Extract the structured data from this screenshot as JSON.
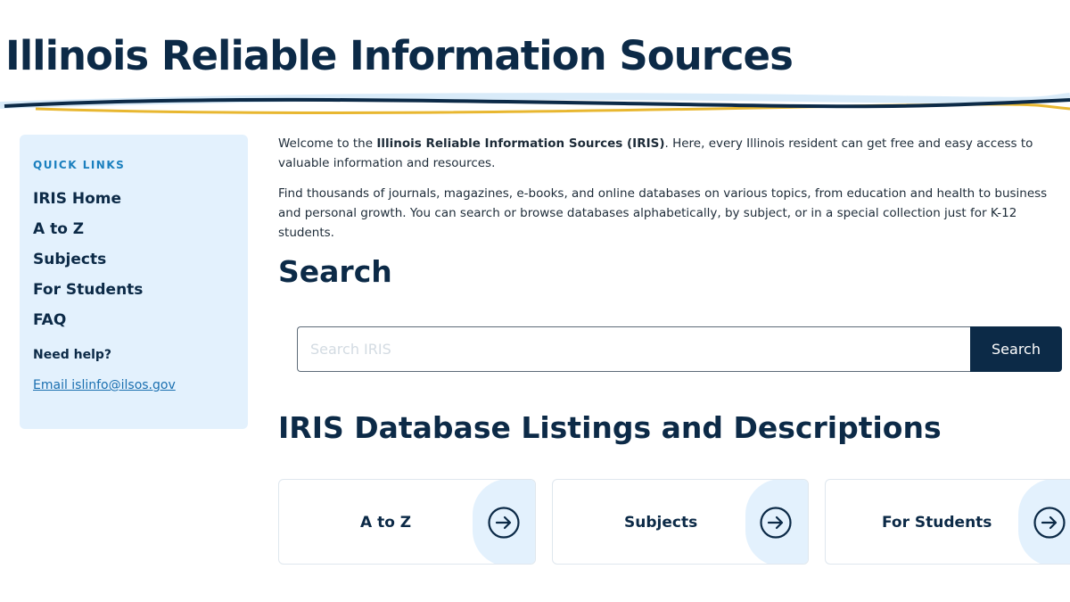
{
  "header": {
    "title": "Illinois Reliable Information Sources"
  },
  "sidebar": {
    "heading": "QUICK LINKS",
    "items": [
      {
        "label": "IRIS Home"
      },
      {
        "label": "A to Z"
      },
      {
        "label": "Subjects"
      },
      {
        "label": "For Students"
      },
      {
        "label": "FAQ"
      }
    ],
    "help_heading": "Need help?",
    "help_link": "Email islinfo@ilsos.gov"
  },
  "intro": {
    "p1_before": "Welcome to the ",
    "p1_bold": "Illinois Reliable Information Sources (IRIS)",
    "p1_after": ". Here, every Illinois resident can get free and easy access to valuable information and resources.",
    "p2": "Find thousands of journals, magazines, e-books, and online databases on various topics, from education and health to business and personal growth. You can search or browse databases alphabetically, by subject, or in a special collection just for K-12 students."
  },
  "search": {
    "heading": "Search",
    "placeholder": "Search IRIS",
    "button_label": "Search"
  },
  "listings": {
    "heading": "IRIS Database Listings and Descriptions",
    "cards": [
      {
        "label": "A to Z",
        "icon": "arrow-circle-right-icon"
      },
      {
        "label": "Subjects",
        "icon": "arrow-circle-right-icon"
      },
      {
        "label": "For Students",
        "icon": "arrow-circle-right-icon"
      }
    ]
  },
  "colors": {
    "navy": "#0c2a47",
    "sidebar_bg": "#e3f1fd",
    "accent_gold": "#e8b730",
    "link_blue": "#1a6fb0"
  }
}
